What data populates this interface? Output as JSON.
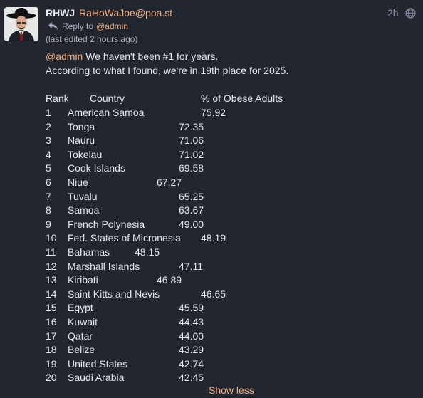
{
  "post": {
    "display_name": "RHWJ",
    "acct": "RaHoWaJoe@poa.st",
    "time": "2h",
    "reply_label": "Reply to",
    "reply_mention": "@admin",
    "edited": "(last edited 2 hours ago)",
    "mention": "@admin",
    "line1_rest": " We haven't been #1 for years.",
    "line2": "According to what I found, we're in 19th place for 2025.",
    "cut_link_text": "Show less",
    "colors": {
      "background": "#22262f",
      "text": "#e3e7ef",
      "accent": "#f1ae7f",
      "muted": "#a8b0c0"
    }
  },
  "table": {
    "headers": {
      "rank": "Rank",
      "country": "Country",
      "pct": "% of Obese Adults"
    },
    "rows": [
      {
        "rank": "1",
        "country": "American Samoa",
        "value": "75.92"
      },
      {
        "rank": "2",
        "country": "Tonga",
        "value": "72.35"
      },
      {
        "rank": "3",
        "country": "Nauru",
        "value": "71.06"
      },
      {
        "rank": "4",
        "country": "Tokelau",
        "value": "71.02"
      },
      {
        "rank": "5",
        "country": "Cook Islands",
        "value": "69.58"
      },
      {
        "rank": "6",
        "country": "Niue",
        "value": "67.27"
      },
      {
        "rank": "7",
        "country": "Tuvalu",
        "value": "65.25"
      },
      {
        "rank": "8",
        "country": "Samoa",
        "value": "63.67"
      },
      {
        "rank": "9",
        "country": "French Polynesia",
        "value": "49.00"
      },
      {
        "rank": "10",
        "country": "Fed. States of Micronesia",
        "value": "48.19"
      },
      {
        "rank": "11",
        "country": "Bahamas",
        "value": "48.15"
      },
      {
        "rank": "12",
        "country": "Marshall Islands",
        "value": "47.11"
      },
      {
        "rank": "13",
        "country": "Kiribati",
        "value": "46.89"
      },
      {
        "rank": "14",
        "country": "Saint Kitts and Nevis",
        "value": "46.65"
      },
      {
        "rank": "15",
        "country": "Egypt",
        "value": "45.59"
      },
      {
        "rank": "16",
        "country": "Kuwait",
        "value": "44.43"
      },
      {
        "rank": "17",
        "country": "Qatar",
        "value": "44.00"
      },
      {
        "rank": "18",
        "country": "Belize",
        "value": "43.29"
      },
      {
        "rank": "19",
        "country": "United States",
        "value": "42.74"
      },
      {
        "rank": "20",
        "country": "Saudi Arabia",
        "value": "42.45"
      }
    ]
  }
}
